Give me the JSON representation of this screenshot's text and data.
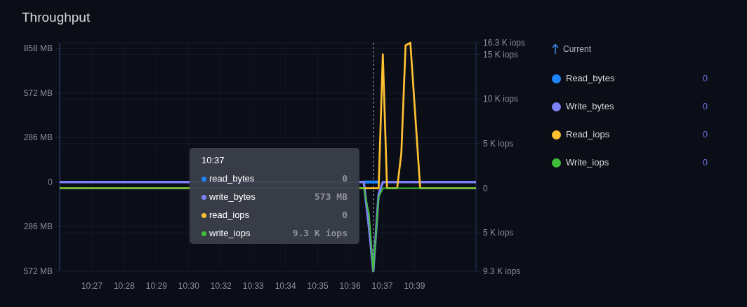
{
  "panel": {
    "title": "Throughput"
  },
  "chart": {
    "chart_data": {
      "type": "line",
      "grid": true,
      "ref_lines": [
        {
          "axis": "x",
          "value": 637.03,
          "color": "#6b7280"
        }
      ],
      "xlim": [
        625.85,
        640.69
      ],
      "ylim": [
        -574,
        896
      ],
      "y2lim": [
        -9.3,
        16.3
      ],
      "xticks": [
        {
          "value": 627,
          "label": "10:27"
        },
        {
          "value": 628.15,
          "label": "10:28"
        },
        {
          "value": 629.3,
          "label": "10:29"
        },
        {
          "value": 630.45,
          "label": "10:30"
        },
        {
          "value": 631.6,
          "label": "10:32"
        },
        {
          "value": 632.75,
          "label": "10:33"
        },
        {
          "value": 633.9,
          "label": "10:34"
        },
        {
          "value": 635.05,
          "label": "10:35"
        },
        {
          "value": 636.2,
          "label": "10:36"
        },
        {
          "value": 637.35,
          "label": "10:37"
        },
        {
          "value": 638.5,
          "label": "10:39"
        }
      ],
      "yticks": [
        {
          "value": 858,
          "label": "858 MB"
        },
        {
          "value": 572,
          "label": "572 MB"
        },
        {
          "value": 286,
          "label": "286 MB"
        },
        {
          "value": 0,
          "label": "0"
        },
        {
          "value": -286,
          "label": "286 MB"
        },
        {
          "value": -572,
          "label": "572 MB"
        }
      ],
      "y2ticks": [
        {
          "value": 16.3,
          "label": "16.3 K iops"
        },
        {
          "value": 15,
          "label": "15 K iops"
        },
        {
          "value": 10,
          "label": "10 K iops"
        },
        {
          "value": 5,
          "label": "5 K iops"
        },
        {
          "value": 0,
          "label": "0"
        },
        {
          "value": -5,
          "label": "5 K iops"
        },
        {
          "value": -9.3,
          "label": "9.3 K iops"
        }
      ],
      "x": [
        625.85,
        636.69,
        636.88,
        637.03,
        637.22,
        637.37,
        637.52,
        637.88,
        638.03,
        638.18,
        638.35,
        638.7,
        640.69
      ],
      "series": [
        {
          "name": "read_bytes",
          "color": "#1f85ff",
          "values": [
            null,
            0,
            0,
            0,
            0,
            null,
            null,
            null,
            null,
            null,
            null,
            null,
            null
          ]
        },
        {
          "name": "write_bytes",
          "color": "#7b80f5",
          "values": [
            0,
            0,
            -300,
            -573,
            -80,
            0,
            0,
            0,
            0,
            0,
            0,
            0,
            0
          ]
        },
        {
          "name": "read_iops",
          "color": "#ffc132",
          "axis": "y2",
          "values": [
            0,
            0,
            0,
            0,
            0,
            15,
            0,
            0,
            4,
            16,
            16.3,
            0,
            0
          ]
        },
        {
          "name": "write_iops",
          "color": "#40bd3a",
          "axis": "y2",
          "values": [
            0,
            0,
            -3,
            -9.3,
            -1,
            0,
            0,
            0,
            0,
            0,
            0,
            0,
            0
          ]
        }
      ]
    },
    "tooltip": {
      "title": "10:37",
      "rows": [
        {
          "value": "0"
        },
        {
          "value": "573 MB"
        },
        {
          "value": "0"
        },
        {
          "value": "9.3 K iops"
        }
      ]
    }
  },
  "legend": {
    "header": "Current",
    "items": [
      {
        "name": "Read_bytes",
        "value": "0",
        "color": "#1f85ff"
      },
      {
        "name": "Write_bytes",
        "value": "0",
        "color": "#7b80f5"
      },
      {
        "name": "Read_iops",
        "value": "0",
        "color": "#ffc132"
      },
      {
        "name": "Write_iops",
        "value": "0",
        "color": "#40bd3a"
      }
    ]
  }
}
